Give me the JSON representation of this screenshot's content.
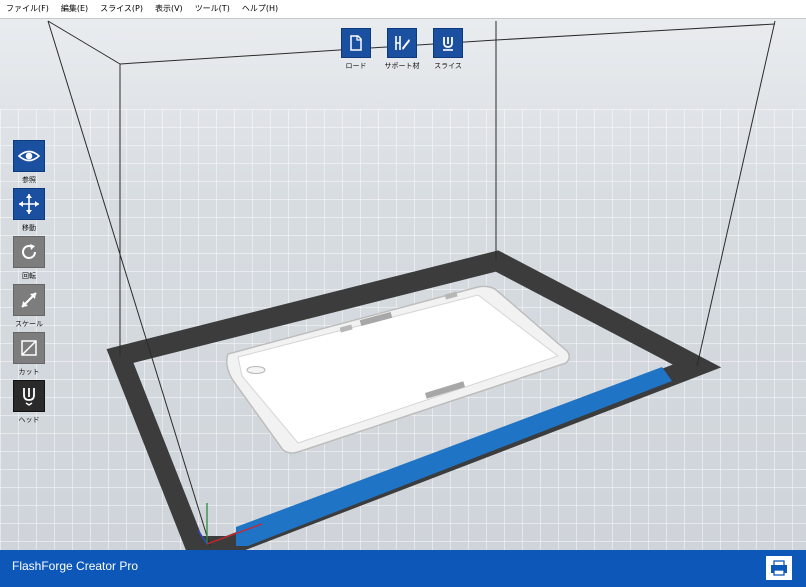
{
  "menu": [
    {
      "label": "ファイル(F)"
    },
    {
      "label": "編集(E)"
    },
    {
      "label": "スライス(P)"
    },
    {
      "label": "表示(V)"
    },
    {
      "label": "ツール(T)"
    },
    {
      "label": "ヘルプ(H)"
    }
  ],
  "top_toolbar": {
    "load": {
      "label": "ロード",
      "icon": "load-file-icon"
    },
    "support": {
      "label": "サポート材",
      "icon": "support-icon"
    },
    "slice": {
      "label": "スライス",
      "icon": "slice-icon"
    }
  },
  "side_toolbar": {
    "view": {
      "label": "参照",
      "icon": "eye-icon"
    },
    "move": {
      "label": "移動",
      "icon": "move-icon"
    },
    "rotate": {
      "label": "回転",
      "icon": "rotate-icon"
    },
    "scale": {
      "label": "スケール",
      "icon": "scale-icon"
    },
    "cut": {
      "label": "カット",
      "icon": "cut-icon"
    },
    "head": {
      "label": "ヘッド",
      "icon": "nozzle-icon"
    }
  },
  "status": {
    "printer_name": "FlashForge Creator Pro",
    "printer_icon": "printer-icon"
  },
  "colors": {
    "accent": "#1b4f9f",
    "status_bar": "#0d57b8",
    "build_plate_border": "#3c3c3c",
    "extruder_zone": "#1f74c6"
  }
}
